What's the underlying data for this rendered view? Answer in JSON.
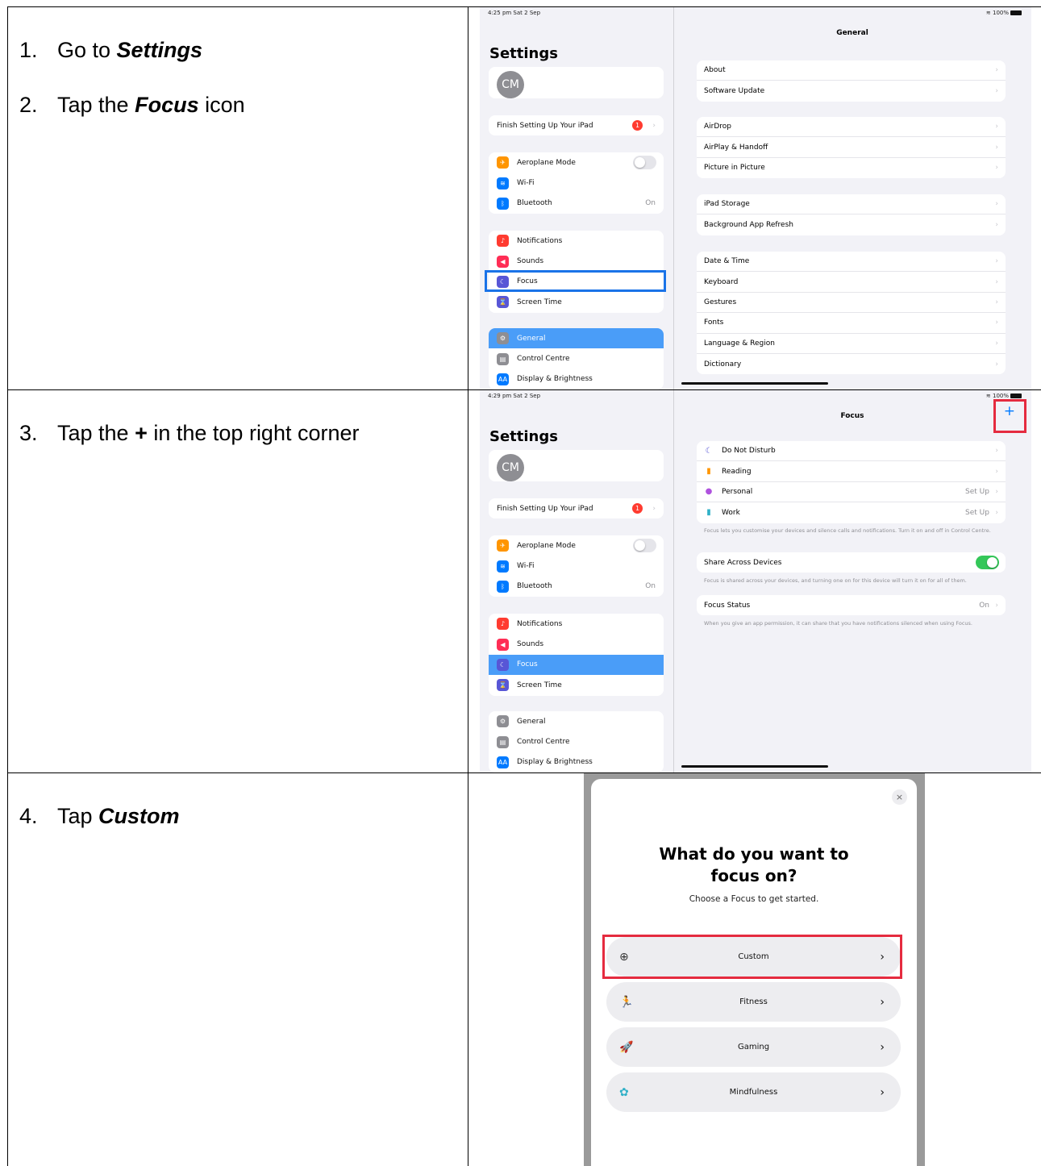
{
  "steps": {
    "s1": {
      "num": "1.",
      "pre": "Go to ",
      "bold": "Settings",
      "post": ""
    },
    "s2": {
      "num": "2.",
      "pre": "Tap the ",
      "bold": "Focus",
      "post": " icon"
    },
    "s3": {
      "num": "3.",
      "pre": "Tap the ",
      "bold": "+",
      "post": " in the top right corner"
    },
    "s4": {
      "num": "4.",
      "pre": "Tap ",
      "bold": "Custom",
      "post": ""
    }
  },
  "screen1": {
    "time": "4:25 pm  Sat 2 Sep",
    "battery": "100%",
    "sidebar_title": "Settings",
    "avatar": "CM",
    "finish_setup": "Finish Setting Up Your iPad",
    "badge": "1",
    "items": [
      {
        "label": "Aeroplane Mode",
        "icon": "airplane-icon",
        "color": "#ff9500",
        "glyph": "✈"
      },
      {
        "label": "Wi-Fi",
        "icon": "wifi-icon",
        "color": "#007aff",
        "glyph": "≋"
      },
      {
        "label": "Bluetooth",
        "icon": "bluetooth-icon",
        "color": "#007aff",
        "glyph": "ᛒ",
        "value": "On"
      },
      {
        "label": "Notifications",
        "icon": "bell-icon",
        "color": "#ff3b30",
        "glyph": "♪"
      },
      {
        "label": "Sounds",
        "icon": "speaker-icon",
        "color": "#ff2d55",
        "glyph": "◀"
      },
      {
        "label": "Focus",
        "icon": "moon-icon",
        "color": "#5856d6",
        "glyph": "☾"
      },
      {
        "label": "Screen Time",
        "icon": "hourglass-icon",
        "color": "#5856d6",
        "glyph": "⌛"
      },
      {
        "label": "General",
        "icon": "gear-icon",
        "color": "#8e8e93",
        "glyph": "⚙"
      },
      {
        "label": "Control Centre",
        "icon": "switches-icon",
        "color": "#8e8e93",
        "glyph": "▤"
      },
      {
        "label": "Display & Brightness",
        "icon": "text-size-icon",
        "color": "#007aff",
        "glyph": "AA"
      }
    ],
    "pane_title": "General",
    "groups": [
      [
        "About",
        "Software Update"
      ],
      [
        "AirDrop",
        "AirPlay & Handoff",
        "Picture in Picture"
      ],
      [
        "iPad Storage",
        "Background App Refresh"
      ],
      [
        "Date & Time",
        "Keyboard",
        "Gestures",
        "Fonts",
        "Language & Region",
        "Dictionary"
      ]
    ]
  },
  "screen2": {
    "time": "4:29 pm  Sat 2 Sep",
    "battery": "100%",
    "pane_title": "Focus",
    "plus": "+",
    "focus_items": [
      {
        "label": "Do Not Disturb",
        "icon": "moon-icon",
        "glyph": "☾",
        "color": "#5856d6",
        "value": ""
      },
      {
        "label": "Reading",
        "icon": "book-icon",
        "glyph": "▮",
        "color": "#ff9500",
        "value": ""
      },
      {
        "label": "Personal",
        "icon": "person-icon",
        "glyph": "●",
        "color": "#af52de",
        "value": "Set Up"
      },
      {
        "label": "Work",
        "icon": "badge-icon",
        "glyph": "▮",
        "color": "#30b0c7",
        "value": "Set Up"
      }
    ],
    "focus_note": "Focus lets you customise your devices and silence calls and notifications. Turn it on and off in Control Centre.",
    "share_label": "Share Across Devices",
    "share_note": "Focus is shared across your devices, and turning one on for this device will turn it on for all of them.",
    "status_label": "Focus Status",
    "status_value": "On",
    "status_note": "When you give an app permission, it can share that you have notifications silenced when using Focus."
  },
  "modal": {
    "title_line1": "What do you want to",
    "title_line2": "focus on?",
    "subtitle": "Choose a Focus to get started.",
    "close": "×",
    "options": [
      {
        "label": "Custom",
        "icon": "plus-circle-icon",
        "glyph": "⊕",
        "color": "#333333"
      },
      {
        "label": "Fitness",
        "icon": "running-icon",
        "glyph": "🏃",
        "color": "#34c759"
      },
      {
        "label": "Gaming",
        "icon": "rocket-icon",
        "glyph": "🚀",
        "color": "#007aff"
      },
      {
        "label": "Mindfulness",
        "icon": "flower-icon",
        "glyph": "✿",
        "color": "#30b0c7"
      }
    ]
  },
  "colors": {
    "highlight_red": "#e52b3f",
    "highlight_blue": "#1a73e8",
    "selected": "#4a9df8"
  }
}
